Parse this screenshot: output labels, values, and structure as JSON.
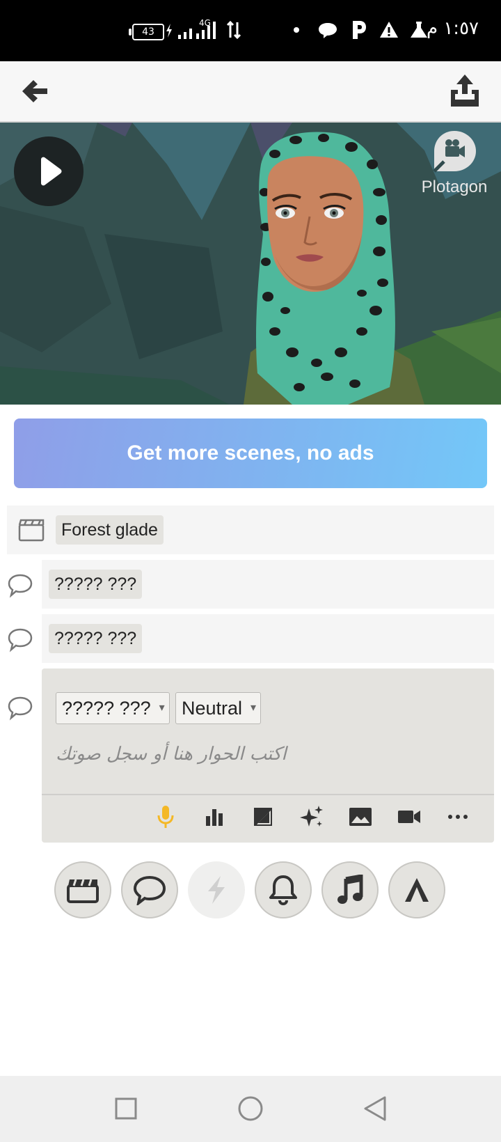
{
  "status_bar": {
    "time": "١:٥٧ م",
    "battery": "43",
    "network": "4G",
    "icons": [
      "battery-icon",
      "charging-icon",
      "signal-icon",
      "data-arrows-icon",
      "dot-icon",
      "chat-icon",
      "parking-icon",
      "warning-icon",
      "flask-icon"
    ]
  },
  "app_bar": {
    "icons": [
      "back-arrow-icon",
      "share-upload-icon"
    ]
  },
  "preview": {
    "watermark": "Plotagon",
    "icons": [
      "play-icon",
      "plotagon-logo-icon"
    ]
  },
  "promo": {
    "label": "Get more scenes, no ads",
    "colors": {
      "start": "#8f9ee8",
      "end": "#73c7f8"
    }
  },
  "script": {
    "scene": {
      "label": "Forest glade",
      "icon": "clapperboard-icon"
    },
    "lines": [
      {
        "text": "????? ???",
        "icon": "speech-bubble-icon"
      },
      {
        "text": "????? ???",
        "icon": "speech-bubble-icon"
      }
    ],
    "editor": {
      "character": "????? ???",
      "emotion": "Neutral",
      "placeholder": "اكتب الحوار هنا أو سجل صوتك",
      "toolbar": [
        "microphone-icon",
        "bar-chart-icon",
        "image-contrast-icon",
        "sparkle-icon",
        "landscape-icon",
        "video-camera-icon",
        "more-icon"
      ],
      "accent": "#f4b826"
    }
  },
  "add_buttons": [
    "clapperboard-icon",
    "speech-bubble-icon",
    "lightning-icon",
    "bell-icon",
    "music-note-icon",
    "text-a-icon"
  ],
  "nav_bar": [
    "recents-square-icon",
    "home-circle-icon",
    "back-triangle-icon"
  ]
}
